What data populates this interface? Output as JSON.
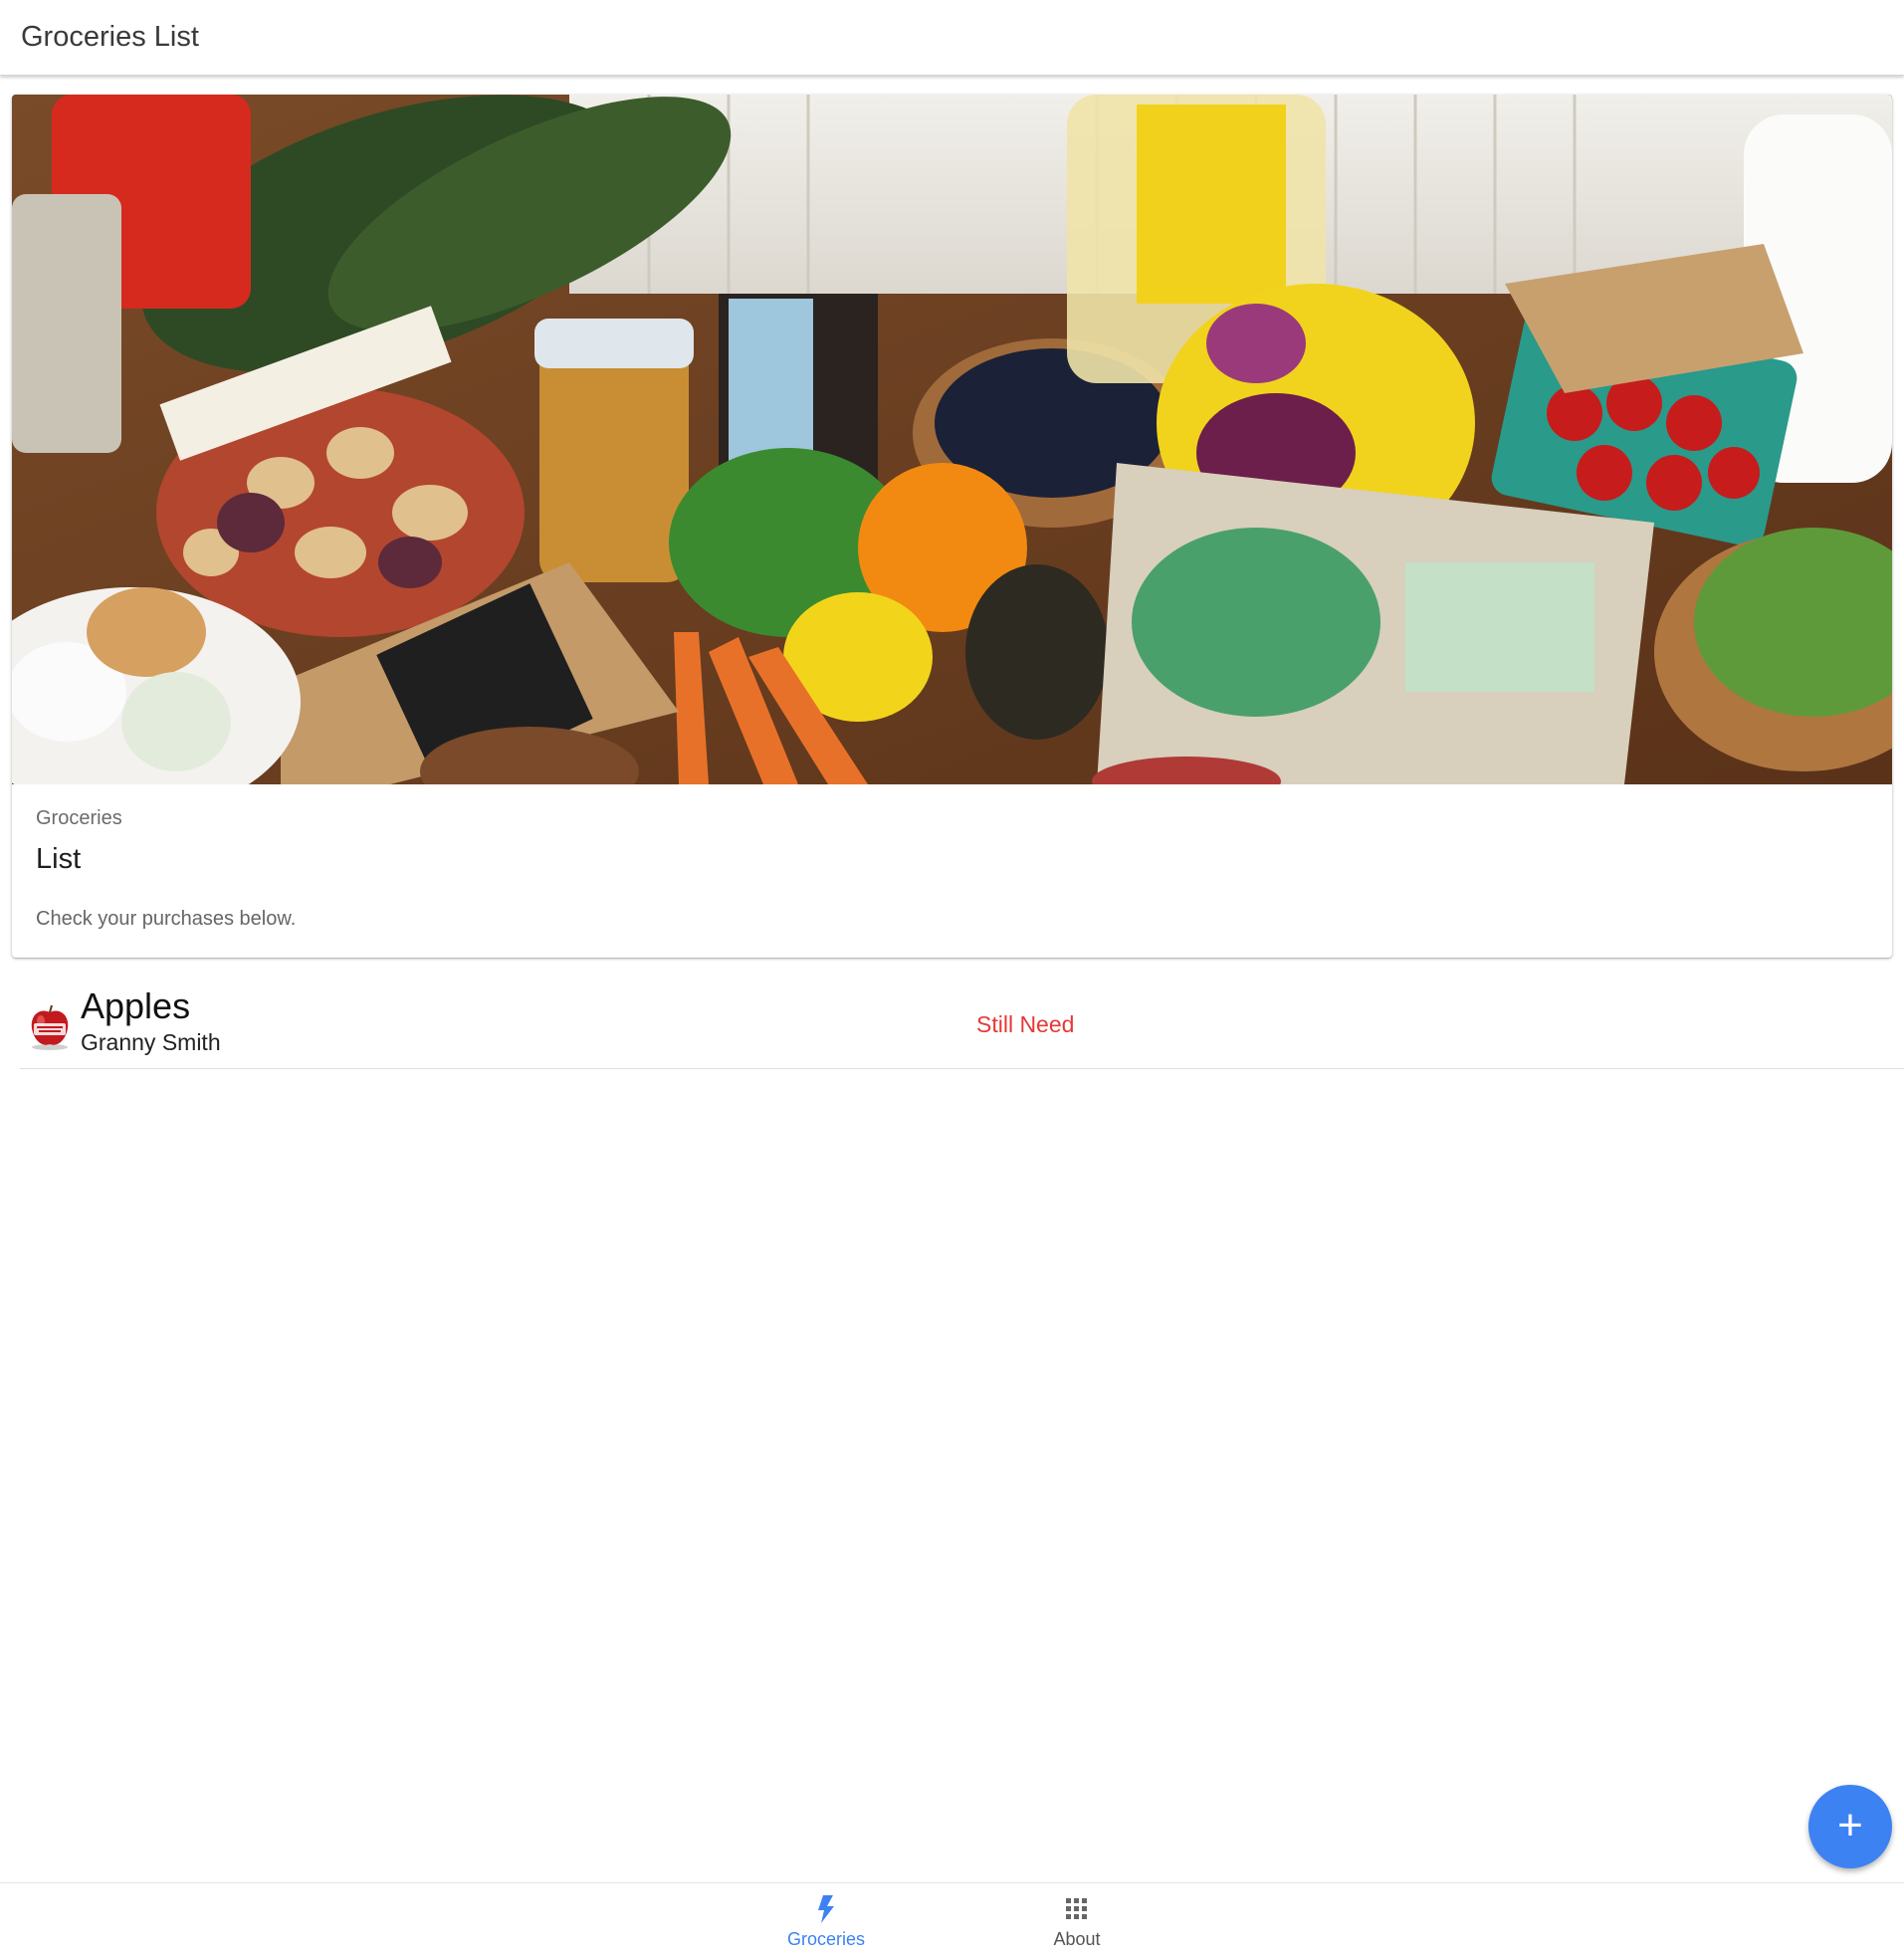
{
  "header": {
    "title": "Groceries List"
  },
  "card": {
    "subtitle": "Groceries",
    "title": "List",
    "text": "Check your purchases below."
  },
  "items": [
    {
      "name": "Apples",
      "variety": "Granny Smith",
      "status": "Still Need",
      "avatar_icon": "apple-photo-coming-soon-icon"
    }
  ],
  "fab": {
    "icon": "plus-icon",
    "label": "+"
  },
  "bottom_nav": [
    {
      "label": "Groceries",
      "icon": "flash-icon",
      "active": true
    },
    {
      "label": "About",
      "icon": "apps-grid-icon",
      "active": false
    }
  ],
  "colors": {
    "accent": "#3d82f3",
    "status_need": "#e53935"
  }
}
